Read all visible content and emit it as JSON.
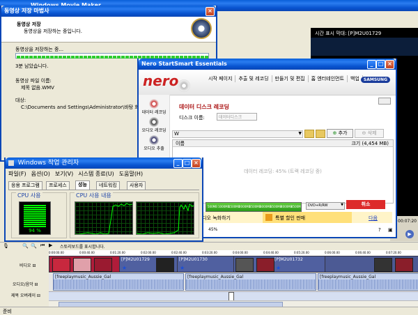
{
  "movie_maker": {
    "title": "Windows Movie Maker",
    "preview_header": "시간 표시 막대: [P]M2U01729",
    "status": "준비",
    "timeline_hint": "스토리보드를 표시합니다.",
    "timecode": "00:07:20",
    "ruler_marks": [
      "0:00:00.00",
      "0:00:40.00",
      "0:01:20.00",
      "0:02:00.00",
      "0:02:40.00",
      "0:03:20.00",
      "0:04:00.00",
      "0:04:40.00",
      "0:05:20.00",
      "0:06:00.00",
      "0:06:40.00",
      "0:07:20.00"
    ],
    "tracks": {
      "video_label": "비디오 ⊟",
      "audio_label": "오디오/음악 ⊟",
      "title_label": "제목 오버레이 ⊟"
    },
    "video_clips": [
      "[P]M2U01729",
      "[P]M2U01730",
      "[P]M2U01732"
    ],
    "audio_clips": [
      "[freeplaymusic_Aussie_Gal",
      "[freeplaymusic_Aussie_Gal",
      "[freeplaymusic_Aussie_Gal"
    ]
  },
  "save_dialog": {
    "title": "동영상 저장 마법사",
    "heading": "동영상 저장",
    "subheading": "동영상을 저장하는 중입니다.",
    "saving_label": "동영상을 저장하는 중...",
    "remaining": "3분 남았습니다.",
    "file_label": "동영상 파일 이름:",
    "file_value": "제목 없음.WMV",
    "dest_label": "대상:",
    "dest_value": "C:\\Documents and Settings\\Administrator\\바탕 화면\\"
  },
  "nero": {
    "title": "Nero StartSmart Essentials",
    "logo": "nero",
    "nav": [
      "시작 페이지",
      "추출 및 레코딩",
      "만들기 및 편집",
      "홈 엔터테인먼트",
      "백업"
    ],
    "brand": "SAMSUNG",
    "side_items": [
      "데이터 레코딩",
      "오디오 레코딩",
      "오디오 추출"
    ],
    "section_title": "데이터 디스크 레코딩",
    "disc_name_label": "디스크 이름:",
    "disc_name_value": "데이터디스크",
    "add_button": "추가",
    "delete_button": "삭제",
    "col_name": "이름",
    "col_size": "크기 (4,454 MB)",
    "recording_status": "데이터 레코딩: 45% (트랙 레코딩 중)",
    "scale": [
      "500MB",
      "1000MB",
      "1500MB",
      "2000MB",
      "2500MB",
      "3000MB",
      "3500MB",
      "4000MB",
      "4500MB"
    ],
    "drive": "DVD+R/RW",
    "cancel_button": "취소",
    "promo_left": "로 비디오 녹화하기",
    "promo_right": "특별 할인 판매",
    "promo_link": "다음",
    "footer_percent": "45%"
  },
  "task_manager": {
    "title": "Windows 작업 관리자",
    "menu": [
      "파일(F)",
      "옵션(O)",
      "보기(V)",
      "시스템 종료(U)",
      "도움말(H)"
    ],
    "tabs": [
      "응용 프로그램",
      "프로세스",
      "성능",
      "네트워킹",
      "사용자"
    ],
    "cpu_usage_label": "CPU 사용",
    "cpu_history_label": "CPU 사용 내용",
    "cpu_percent": "94 %",
    "cpu_usage_value": 0.94
  },
  "colors": {
    "xp_blue": "#0a5fd8",
    "nero_red": "#cc2222",
    "graph_green": "#00ff00"
  }
}
